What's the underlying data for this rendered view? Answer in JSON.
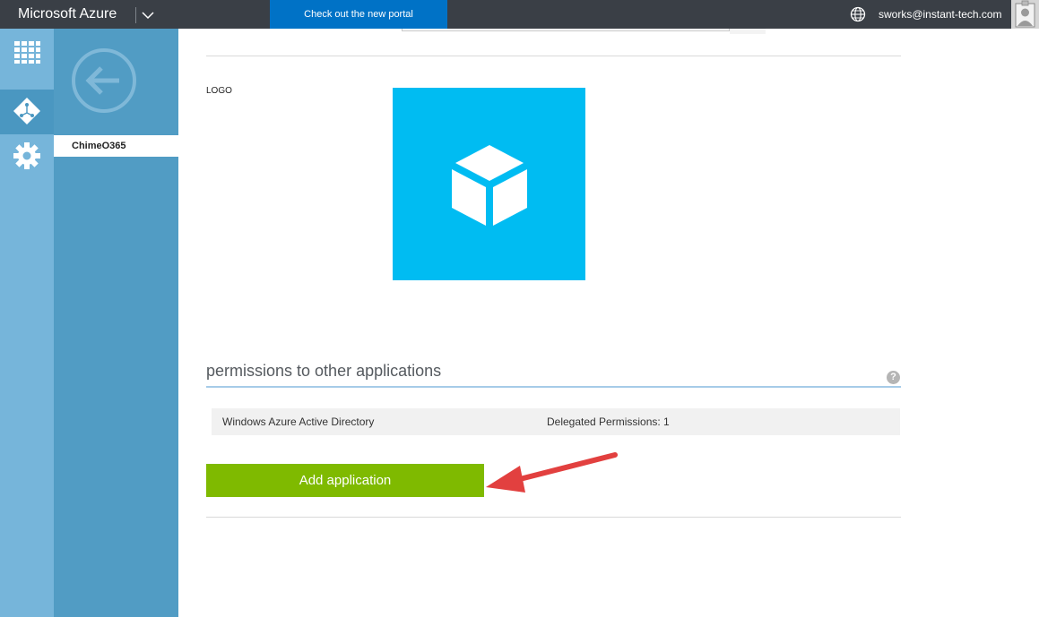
{
  "topbar": {
    "brand": "Microsoft Azure",
    "portal_link": "Check out the new portal",
    "user_email": "sworks@instant-tech.com"
  },
  "rail": {
    "items": [
      {
        "icon": "grid-icon"
      },
      {
        "icon": "directory-icon",
        "active": true
      },
      {
        "icon": "gear-icon"
      }
    ]
  },
  "subnav": {
    "back_icon": "back-arrow-icon",
    "selected_item": "ChimeO365"
  },
  "main": {
    "logo_label": "LOGO",
    "logo_icon": "cube-icon",
    "permissions": {
      "title": "permissions to other applications",
      "help": "?",
      "rows": [
        {
          "application": "Windows Azure Active Directory",
          "value": "Delegated Permissions: 1"
        }
      ]
    },
    "add_button_label": "Add application"
  },
  "colors": {
    "topbar": "#3a3f46",
    "portal_button": "#0072c6",
    "rail": "#76b5da",
    "subnav": "#519cc4",
    "logo_tile": "#00bcf2",
    "add_button": "#7fba00",
    "arrow": "#e2403f"
  }
}
